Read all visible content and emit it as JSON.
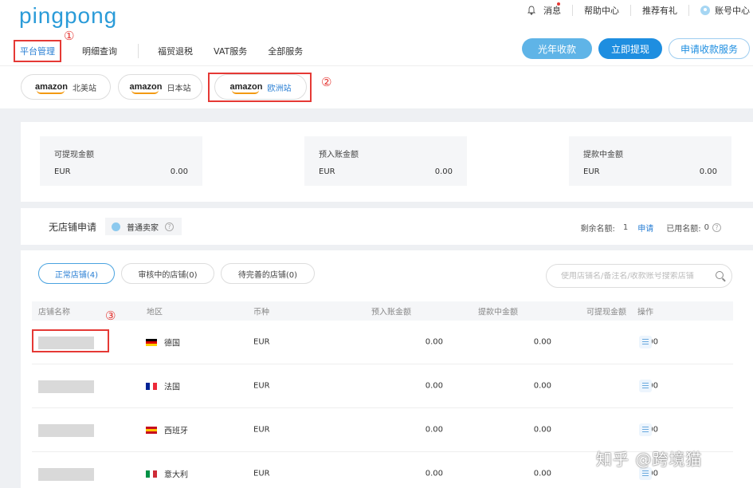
{
  "brand": {
    "logo": "pingpong"
  },
  "top_links": {
    "messages": "消息",
    "help": "帮助中心",
    "referral": "推荐有礼",
    "account": "账号中心"
  },
  "main_nav": [
    {
      "label": "平台管理",
      "active": true
    },
    {
      "label": "明细查询"
    },
    {
      "label": "福贸退税"
    },
    {
      "label": "VAT服务"
    },
    {
      "label": "全部服务"
    }
  ],
  "actions": {
    "guangnian": "光年收款",
    "withdraw": "立即提现",
    "apply": "申请收款服务"
  },
  "annotations": {
    "one": "①",
    "two": "②",
    "three": "③"
  },
  "sites": [
    {
      "brand": "amazon",
      "label": "北美站"
    },
    {
      "brand": "amazon",
      "label": "日本站"
    },
    {
      "brand": "amazon",
      "label": "欧洲站",
      "active": true
    }
  ],
  "balances": [
    {
      "title": "可提现金额",
      "currency": "EUR",
      "amount": "0.00"
    },
    {
      "title": "预入账金额",
      "currency": "EUR",
      "amount": "0.00"
    },
    {
      "title": "提款中金额",
      "currency": "EUR",
      "amount": "0.00"
    }
  ],
  "store_header": {
    "title": "无店铺申请",
    "seller_type": "普通卖家",
    "help_icon": "?",
    "remaining_label": "剩余名额:",
    "remaining_value": "1",
    "apply_link": "申请",
    "used_label": "已用名额:",
    "used_value": "0"
  },
  "tabs": [
    {
      "label": "正常店铺(4)",
      "active": true
    },
    {
      "label": "审核中的店铺(0)"
    },
    {
      "label": "待完善的店铺(0)"
    }
  ],
  "search": {
    "placeholder": "使用店铺名/备注名/收款账号搜索店铺"
  },
  "table": {
    "headers": [
      "店铺名称",
      "地区",
      "币种",
      "预入账金额",
      "提款中金额",
      "可提现金额",
      "操作"
    ],
    "rows": [
      {
        "region": "德国",
        "currency": "EUR",
        "pending": "0.00",
        "withdrawing": "0.00",
        "available": "0.00",
        "flag": [
          "#000000",
          "#dd0000",
          "#ffce00"
        ],
        "flag_dir": "h"
      },
      {
        "region": "法国",
        "currency": "EUR",
        "pending": "0.00",
        "withdrawing": "0.00",
        "available": "0.00",
        "flag": [
          "#002395",
          "#ffffff",
          "#ed2939"
        ],
        "flag_dir": "v"
      },
      {
        "region": "西班牙",
        "currency": "EUR",
        "pending": "0.00",
        "withdrawing": "0.00",
        "available": "0.00",
        "flag": [
          "#c60b1e",
          "#ffc400",
          "#c60b1e"
        ],
        "flag_dir": "h"
      },
      {
        "region": "意大利",
        "currency": "EUR",
        "pending": "0.00",
        "withdrawing": "0.00",
        "available": "0.00",
        "flag": [
          "#009246",
          "#ffffff",
          "#ce2b37"
        ],
        "flag_dir": "v"
      }
    ]
  },
  "watermark": "知乎 @跨境猫",
  "colors": {
    "primary": "#1e8ee0",
    "brand": "#2a9bd8",
    "annotation": "#e53935",
    "amazon_smile": "#f39a12"
  }
}
